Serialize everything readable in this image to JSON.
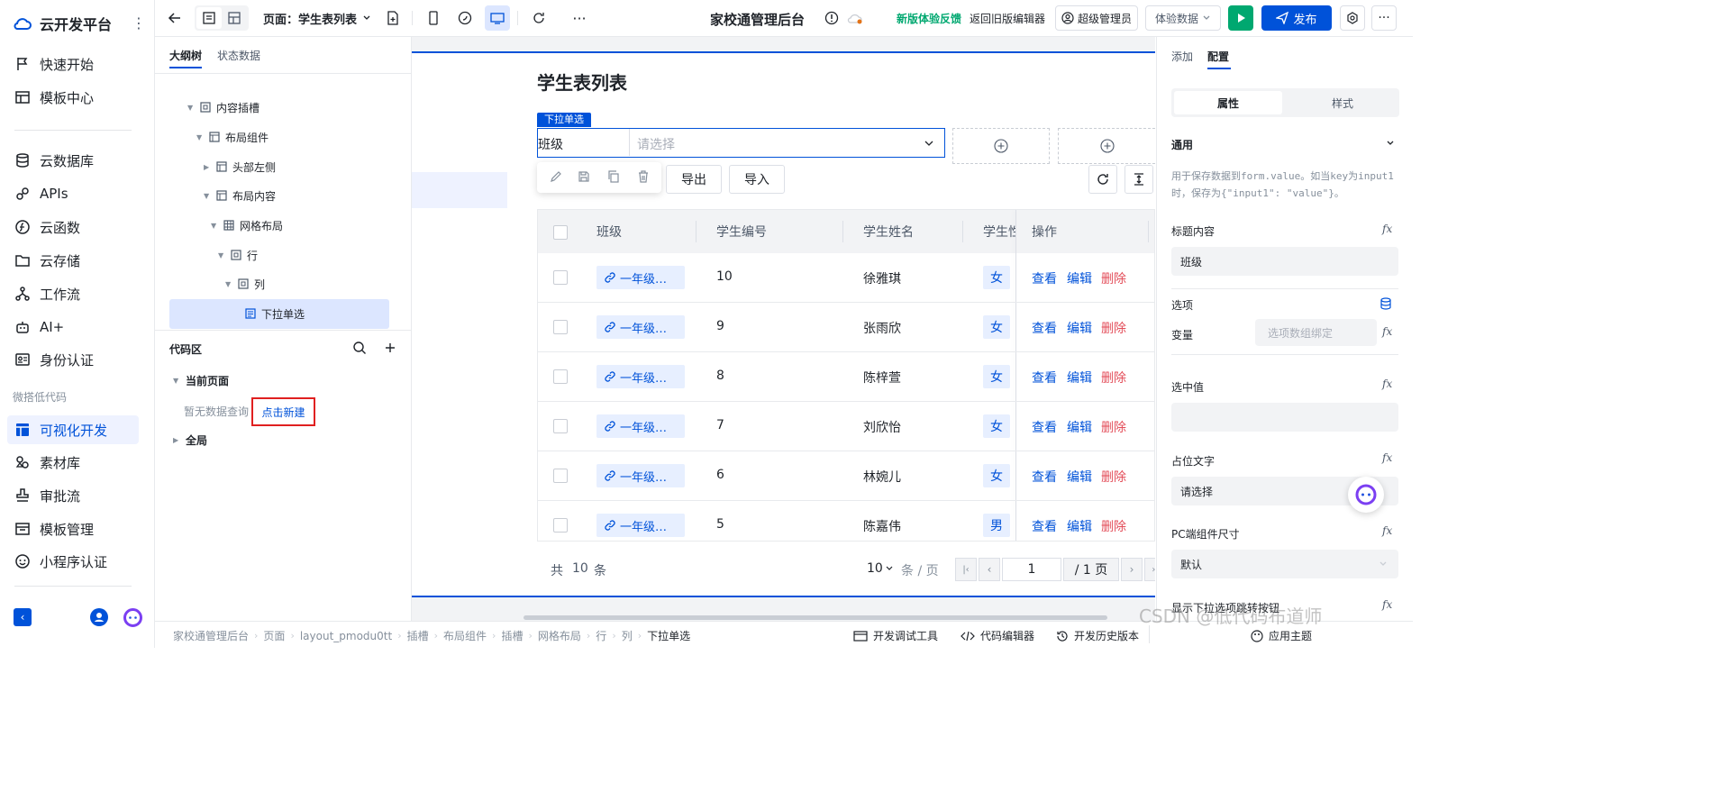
{
  "nav": {
    "brand": "云开发平台",
    "items": [
      {
        "label": "快速开始",
        "icon": "flag-icon"
      },
      {
        "label": "模板中心",
        "icon": "template-icon"
      },
      {
        "label": "云数据库",
        "icon": "database-icon"
      },
      {
        "label": "APIs",
        "icon": "api-icon"
      },
      {
        "label": "云函数",
        "icon": "function-icon"
      },
      {
        "label": "云存储",
        "icon": "folder-cloud-icon"
      },
      {
        "label": "工作流",
        "icon": "workflow-icon"
      },
      {
        "label": "AI+",
        "icon": "robot-icon"
      },
      {
        "label": "身份认证",
        "icon": "id-card-icon"
      }
    ],
    "section_label": "微搭低代码",
    "low_code_items": [
      {
        "label": "可视化开发",
        "icon": "layout-icon",
        "active": true
      },
      {
        "label": "素材库",
        "icon": "materials-icon"
      },
      {
        "label": "审批流",
        "icon": "stamp-icon"
      },
      {
        "label": "模板管理",
        "icon": "template-manage-icon"
      },
      {
        "label": "小程序认证",
        "icon": "miniprogram-icon"
      }
    ]
  },
  "topbar": {
    "page_select": "页面：学生表列表",
    "app_title": "家校通管理后台",
    "feedback": "新版体验反馈",
    "back_old": "返回旧版编辑器",
    "user": "超级管理员",
    "experience_data": "体验数据",
    "publish": "发布",
    "accent": "#0052d9",
    "run_color": "#00a870"
  },
  "outline": {
    "tabs": [
      "大纲树",
      "状态数据"
    ],
    "tree": [
      {
        "label": "内容插槽",
        "indent": 0
      },
      {
        "label": "布局组件",
        "indent": 1
      },
      {
        "label": "头部左侧",
        "indent": 2
      },
      {
        "label": "布局内容",
        "indent": 2
      },
      {
        "label": "网格布局",
        "indent": 3
      },
      {
        "label": "行",
        "indent": 4
      },
      {
        "label": "列",
        "indent": 5
      },
      {
        "label": "下拉单选",
        "indent": 6,
        "selected": true
      }
    ],
    "code_area": "代码区",
    "current_page": "当前页面",
    "empty_query": "暂无数据查询",
    "create_new": "点击新建",
    "global": "全局"
  },
  "canvas": {
    "page_title": "学生表列表",
    "selected_component_tag": "下拉单选",
    "select_label": "班级",
    "select_placeholder": "请选择",
    "export_btn": "导出",
    "import_btn": "导入",
    "table": {
      "headers": [
        "班级",
        "学生编号",
        "学生姓名",
        "学生性",
        "操作"
      ],
      "rows": [
        {
          "class": "一年级…",
          "id": "10",
          "name": "徐雅琪",
          "sex": "女"
        },
        {
          "class": "一年级…",
          "id": "9",
          "name": "张雨欣",
          "sex": "女"
        },
        {
          "class": "一年级…",
          "id": "8",
          "name": "陈梓萱",
          "sex": "女"
        },
        {
          "class": "一年级…",
          "id": "7",
          "name": "刘欣怡",
          "sex": "女"
        },
        {
          "class": "一年级…",
          "id": "6",
          "name": "林婉儿",
          "sex": "女"
        },
        {
          "class": "一年级…",
          "id": "5",
          "name": "陈嘉伟",
          "sex": "男"
        }
      ],
      "ops": {
        "view": "查看",
        "edit": "编辑",
        "delete": "删除"
      }
    },
    "pagination": {
      "total_prefix": "共",
      "total": "10",
      "total_suffix": "条",
      "page_size": "10",
      "page_size_unit": "条 / 页",
      "current_page": "1",
      "total_pages": "/ 1 页"
    }
  },
  "rpanel": {
    "tabs": [
      "添加",
      "配置"
    ],
    "seg": [
      "属性",
      "样式"
    ],
    "section": "通用",
    "hint": "用于保存数据到form.value。如当key为input1时，保存为{\"input1\": \"value\"}。",
    "title_label": "标题内容",
    "title_value": "班级",
    "options_label": "选项",
    "variable_label": "变量",
    "variable_placeholder": "选项数组绑定",
    "selected_label": "选中值",
    "selected_value": "",
    "placeholder_label": "占位文字",
    "placeholder_value": "请选择",
    "size_label": "PC端组件尺寸",
    "size_value": "默认",
    "jump_label": "显示下拉选项跳转按钮",
    "fx": "fx"
  },
  "bottombar": {
    "breadcrumb": [
      "家校通管理后台",
      "页面",
      "layout_pmodu0tt",
      "插槽",
      "布局组件",
      "插槽",
      "网格布局",
      "行",
      "列",
      "下拉单选"
    ],
    "dev_tools": "开发调试工具",
    "code_editor": "代码编辑器",
    "history": "开发历史版本",
    "apply_theme": "应用主题",
    "watermark": "CSDN @低代码布道师"
  }
}
